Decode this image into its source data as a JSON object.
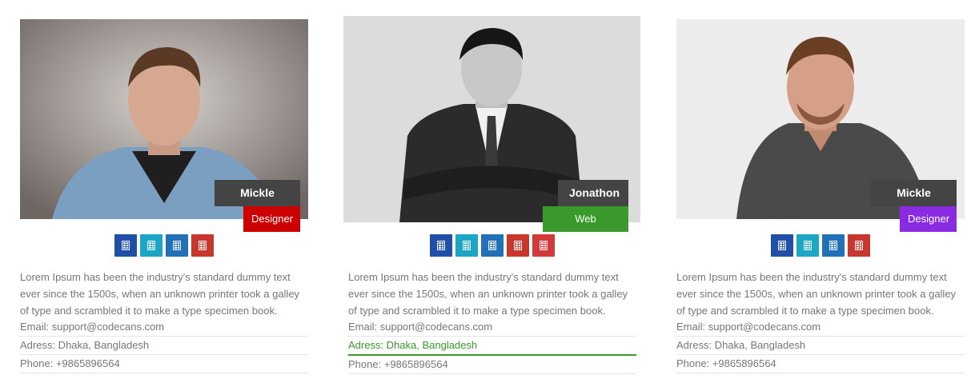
{
  "cards": [
    {
      "name": "Mickle Bond",
      "role": "Designer",
      "role_color": "#cc0000",
      "description": "Lorem Ipsum has been the industry's standard dummy text ever since the 1500s, when an unknown printer took a galley of type and scrambled it to make a type specimen book.",
      "email": "Email: support@codecans.com",
      "address": "Adress: Dhaka, Bangladesh",
      "phone": "Phone: +9865896564",
      "socials": [
        {
          "icon": "facebook-icon",
          "color": "#1f4fa6"
        },
        {
          "icon": "twitter-icon",
          "color": "#1aa6c4"
        },
        {
          "icon": "linkedin-icon",
          "color": "#2270b8"
        },
        {
          "icon": "google-plus-icon",
          "color": "#c8372d"
        }
      ]
    },
    {
      "name": "Jonathon",
      "role": "Web Developer",
      "role_color": "#3a9a2c",
      "description": "Lorem Ipsum has been the industry's standard dummy text ever since the 1500s, when an unknown printer took a galley of type and scrambled it to make a type specimen book.",
      "email": "Email: support@codecans.com",
      "address": "Adress: Dhaka, Bangladesh",
      "phone": "Phone: +9865896564",
      "socials": [
        {
          "icon": "facebook-icon",
          "color": "#1f4fa6"
        },
        {
          "icon": "twitter-icon",
          "color": "#1aa6c4"
        },
        {
          "icon": "linkedin-icon",
          "color": "#2270b8"
        },
        {
          "icon": "google-plus-icon",
          "color": "#c8372d"
        },
        {
          "icon": "pinterest-icon",
          "color": "#d23a3a"
        }
      ]
    },
    {
      "name": "Mickle Bond",
      "role": "Designer",
      "role_color": "#8a2be2",
      "description": "Lorem Ipsum has been the industry's standard dummy text ever since the 1500s, when an unknown printer took a galley of type and scrambled it to make a type specimen book.",
      "email": "Email: support@codecans.com",
      "address": "Adress: Dhaka, Bangladesh",
      "phone": "Phone: +9865896564",
      "socials": [
        {
          "icon": "facebook-icon",
          "color": "#1f4fa6"
        },
        {
          "icon": "twitter-icon",
          "color": "#1aa6c4"
        },
        {
          "icon": "linkedin-icon",
          "color": "#2270b8"
        },
        {
          "icon": "google-plus-icon",
          "color": "#c8372d"
        }
      ]
    }
  ]
}
